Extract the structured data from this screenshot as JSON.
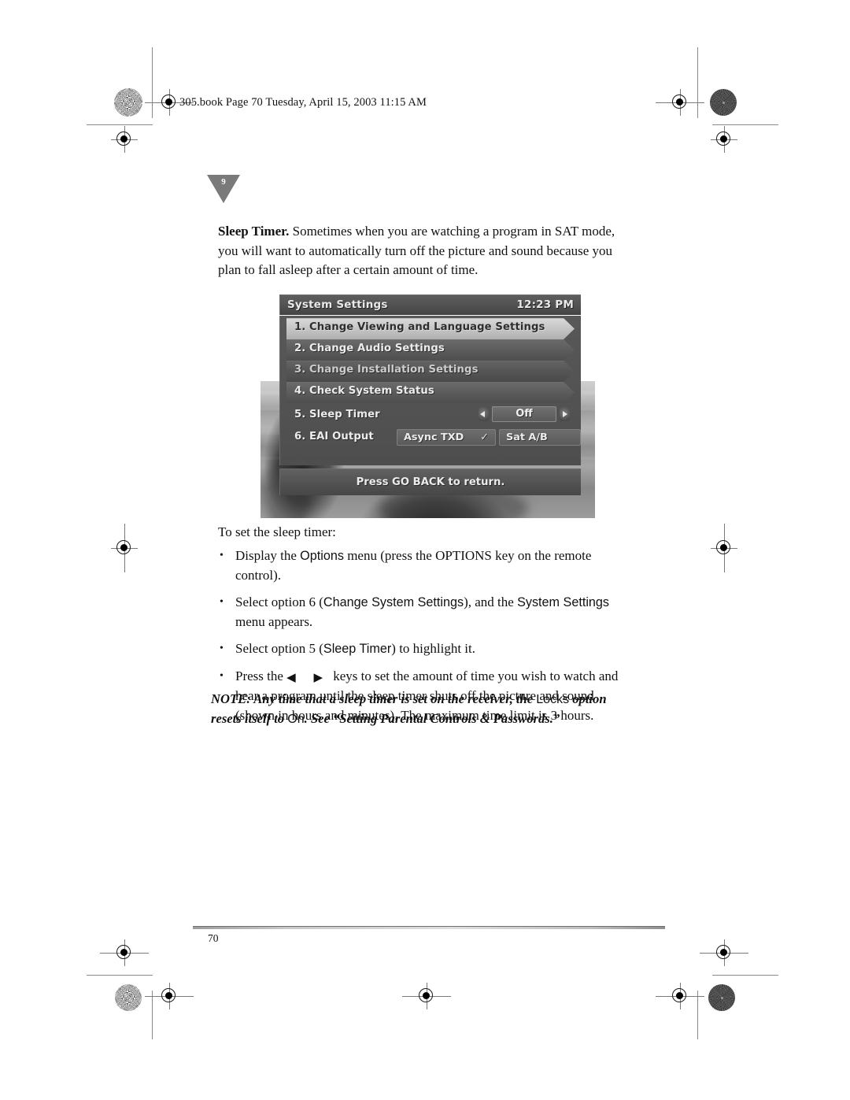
{
  "header": {
    "running_head": "305.book  Page 70  Tuesday, April 15, 2003  11:15 AM"
  },
  "chapter_marker": {
    "number": "9"
  },
  "body": {
    "intro_bold": "Sleep Timer.",
    "intro_text": " Sometimes when you are watching a program in SAT mode, you will want to automatically turn off the picture and sound because you plan to fall asleep after a certain amount of time.",
    "lead_in": "To set the sleep timer:",
    "bullets": [
      {
        "marker": "•",
        "seg1": "Display the ",
        "ui1": "Options",
        "seg2": " menu (press the OPTIONS key on the remote control)."
      },
      {
        "marker": "•",
        "seg1": "Select option 6 (",
        "ui1": "Change System Settings",
        "seg2": "), and the ",
        "ui2": "System Settings",
        "seg3": " menu appears."
      },
      {
        "marker": "•",
        "seg1": "Select option 5 (",
        "ui1": "Sleep Timer",
        "seg2": ") to highlight it."
      },
      {
        "marker": "•",
        "seg1": "Press the ",
        "arrows": "◀  ▶",
        "seg2": " keys to set the amount of time you wish to watch and hear a program until the sleep timer shuts off the picture and sound (shown in hours and minutes). The maximum time limit is 3 hours."
      }
    ],
    "note": {
      "seg1": "NOTE: Any time that a sleep timer is set on the receiver, the ",
      "ui1": "Locks",
      "seg2": " option resets itself to ",
      "ui2": "On",
      "seg3": ". See “Setting Parental Controls & Passwords.”"
    }
  },
  "tv_screenshot": {
    "title": "System Settings",
    "clock": "12:23 PM",
    "rows": [
      {
        "index": "1.",
        "label": "Change Viewing and Language Settings",
        "state": "selected"
      },
      {
        "index": "2.",
        "label": "Change Audio Settings",
        "state": "normal"
      },
      {
        "index": "3.",
        "label": "Change Installation Settings",
        "state": "dim"
      },
      {
        "index": "4.",
        "label": "Check System Status",
        "state": "normal"
      }
    ],
    "sleep_timer": {
      "index": "5.",
      "label": "Sleep Timer",
      "value": "Off",
      "left_arrow": "◀",
      "right_arrow": "▶"
    },
    "eai_output": {
      "index": "6.",
      "label": "EAI Output",
      "field1": "Async TXD",
      "field1_check": "✓",
      "field2": "Sat A/B"
    },
    "footer_hint": "Press GO BACK to return."
  },
  "footer": {
    "page_number": "70"
  }
}
